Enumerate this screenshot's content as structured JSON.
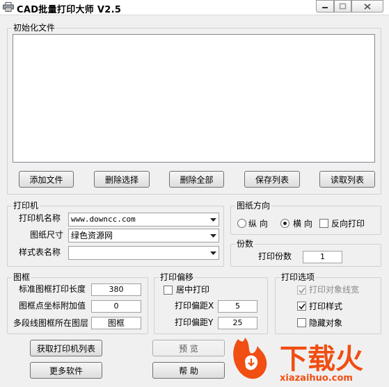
{
  "window": {
    "title": "CAD批量打印大师 V2.5",
    "controls": [
      "minimize",
      "maximize",
      "close"
    ]
  },
  "init_files": {
    "group_label": "初始化文件",
    "files": [],
    "buttons": {
      "add": "添加文件",
      "delete_selected": "删除选择",
      "delete_all": "删除全部",
      "save_list": "保存列表",
      "read_list": "读取列表"
    }
  },
  "printer": {
    "group_label": "打印机",
    "name_label": "打印机名称",
    "name_value": "www.downcc.com",
    "paper_label": "图纸尺寸",
    "paper_value": "绿色资源网",
    "style_label": "样式表名称",
    "style_value": ""
  },
  "orientation": {
    "group_label": "图纸方向",
    "portrait": "纵 向",
    "landscape": "横 向",
    "reverse": "反向打印",
    "selected": "landscape",
    "reverse_checked": false
  },
  "copies": {
    "group_label": "份数",
    "label": "打印份数",
    "value": "1"
  },
  "frame": {
    "group_label": "图框",
    "length_label": "标准图框打印长度",
    "length_value": "380",
    "offset_label": "图框点坐标附加值",
    "offset_value": "0",
    "layer_label": "多段线图框所在图层",
    "layer_value": "图框"
  },
  "print_offset": {
    "group_label": "打印偏移",
    "center_label": "居中打印",
    "center_checked": false,
    "x_label": "打印偏距X",
    "x_value": "5",
    "y_label": "打印偏距Y",
    "y_value": "25"
  },
  "print_options": {
    "group_label": "打印选项",
    "lineweight_label": "打印对象线宽",
    "lineweight_checked": true,
    "lineweight_enabled": false,
    "style_label": "打印样式",
    "style_checked": true,
    "hide_label": "隐藏对象",
    "hide_checked": false
  },
  "bottom_buttons": {
    "get_printers": "获取打印机列表",
    "preview": "预 览",
    "more_software": "更多软件",
    "help": "帮 助"
  },
  "watermark": {
    "brand": "下载火",
    "url": "xiazaihuo.com"
  },
  "colors": {
    "window_bg": "#f0f0f0",
    "brand_orange": "#f04e12"
  }
}
